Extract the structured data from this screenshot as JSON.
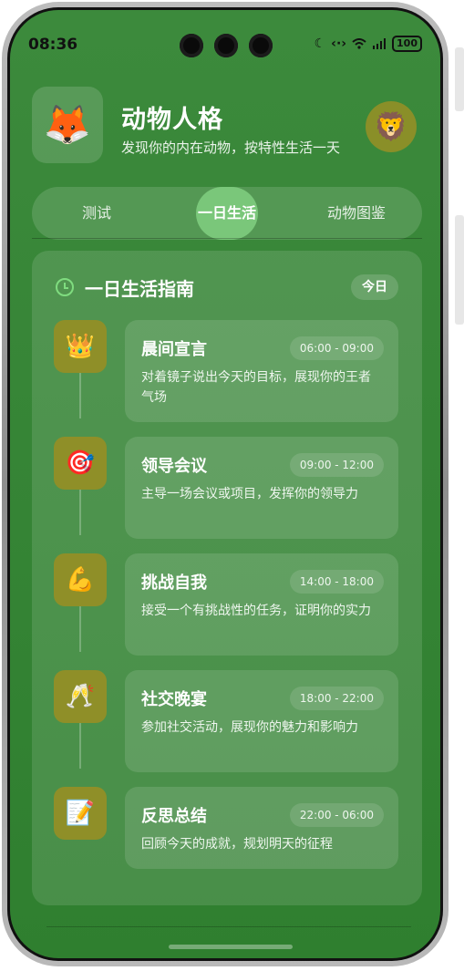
{
  "status_bar": {
    "time": "08:36",
    "battery": "100",
    "icons": [
      "moon-icon",
      "data-transfer-icon",
      "wifi-icon",
      "signal-icon"
    ]
  },
  "app": {
    "logo_emoji": "🦊",
    "title": "动物人格",
    "subtitle": "发现你的内在动物，按特性生活一天",
    "avatar_emoji": "🦁"
  },
  "tabs": [
    {
      "label": "测试",
      "active": false
    },
    {
      "label": "一日生活",
      "active": true
    },
    {
      "label": "动物图鉴",
      "active": false
    }
  ],
  "guide": {
    "title": "一日生活指南",
    "badge": "今日",
    "items": [
      {
        "icon": "👑",
        "icon_name": "crown-icon",
        "title": "晨间宣言",
        "time": "06:00 - 09:00",
        "desc": "对着镜子说出今天的目标，展现你的王者气场"
      },
      {
        "icon": "🎯",
        "icon_name": "target-icon",
        "title": "领导会议",
        "time": "09:00 - 12:00",
        "desc": "主导一场会议或项目，发挥你的领导力"
      },
      {
        "icon": "💪",
        "icon_name": "flexed-biceps-icon",
        "title": "挑战自我",
        "time": "14:00 - 18:00",
        "desc": "接受一个有挑战性的任务，证明你的实力"
      },
      {
        "icon": "🥂",
        "icon_name": "champagne-glasses-icon",
        "title": "社交晚宴",
        "time": "18:00 - 22:00",
        "desc": "参加社交活动，展现你的魅力和影响力"
      },
      {
        "icon": "📝",
        "icon_name": "memo-icon",
        "title": "反思总结",
        "time": "22:00 - 06:00",
        "desc": "回顾今天的成就，规划明天的征程"
      }
    ]
  }
}
